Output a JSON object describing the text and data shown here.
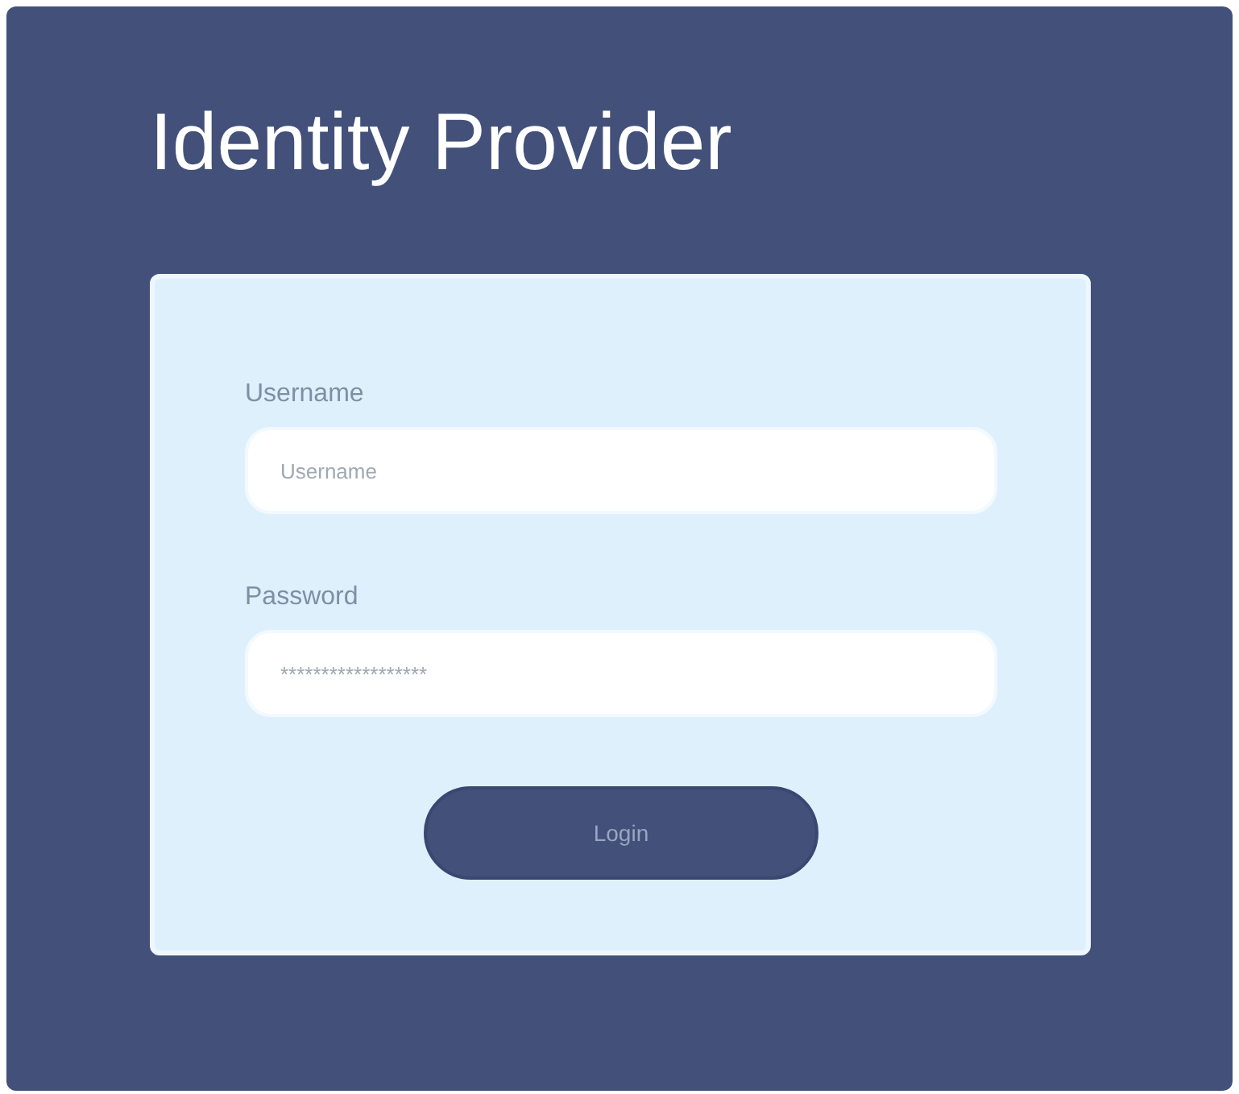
{
  "title": "Identity Provider",
  "form": {
    "fields": [
      {
        "label": "Username",
        "placeholder": "Username"
      },
      {
        "label": "Password",
        "value": "******************"
      }
    ],
    "button": "Login"
  }
}
